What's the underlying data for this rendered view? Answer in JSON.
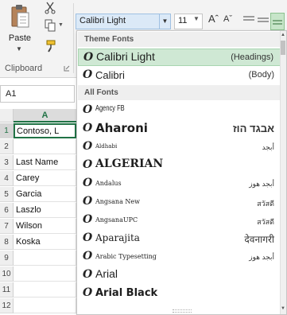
{
  "ribbon": {
    "paste_label": "Paste",
    "clipboard_label": "Clipboard",
    "font_box_value": "Calibri Light",
    "font_size_value": "11",
    "grow_font": "Aˆ",
    "shrink_font": "Aˇ",
    "icons": {
      "paste": "paste-icon",
      "cut": "cut-icon",
      "copy": "copy-icon",
      "painter": "format-painter-icon",
      "launcher": "dialog-launcher-icon"
    }
  },
  "namebox": {
    "value": "A1"
  },
  "grid": {
    "column_header": "A",
    "rows": [
      {
        "num": "1",
        "value": "Contoso, L"
      },
      {
        "num": "2",
        "value": ""
      },
      {
        "num": "3",
        "value": "Last Name"
      },
      {
        "num": "4",
        "value": "Carey"
      },
      {
        "num": "5",
        "value": "Garcia"
      },
      {
        "num": "6",
        "value": "Laszlo"
      },
      {
        "num": "7",
        "value": "Wilson"
      },
      {
        "num": "8",
        "value": "Koska"
      },
      {
        "num": "9",
        "value": ""
      },
      {
        "num": "10",
        "value": ""
      },
      {
        "num": "11",
        "value": ""
      },
      {
        "num": "12",
        "value": ""
      }
    ]
  },
  "dropdown": {
    "theme_header": "Theme Fonts",
    "all_header": "All Fonts",
    "font_type_glyph": "O",
    "theme_fonts": [
      {
        "name": "Calibri Light",
        "sample": "(Headings)"
      },
      {
        "name": "Calibri",
        "sample": "(Body)"
      }
    ],
    "all_fonts": [
      {
        "name": "Agency FB",
        "sample": ""
      },
      {
        "name": "Aharoni",
        "sample": "אבגד הוז"
      },
      {
        "name": "Aldhabi",
        "sample": "أبجد"
      },
      {
        "name": "ALGERIAN",
        "sample": ""
      },
      {
        "name": "Andalus",
        "sample": "أبجد هوز"
      },
      {
        "name": "Angsana New",
        "sample": "สวัสดี"
      },
      {
        "name": "AngsanaUPC",
        "sample": "สวัสดี"
      },
      {
        "name": "Aparajita",
        "sample": "देवनागरी"
      },
      {
        "name": "Arabic Typesetting",
        "sample": "أبجد هوز"
      },
      {
        "name": "Arial",
        "sample": ""
      },
      {
        "name": "Arial Black",
        "sample": ""
      }
    ]
  }
}
